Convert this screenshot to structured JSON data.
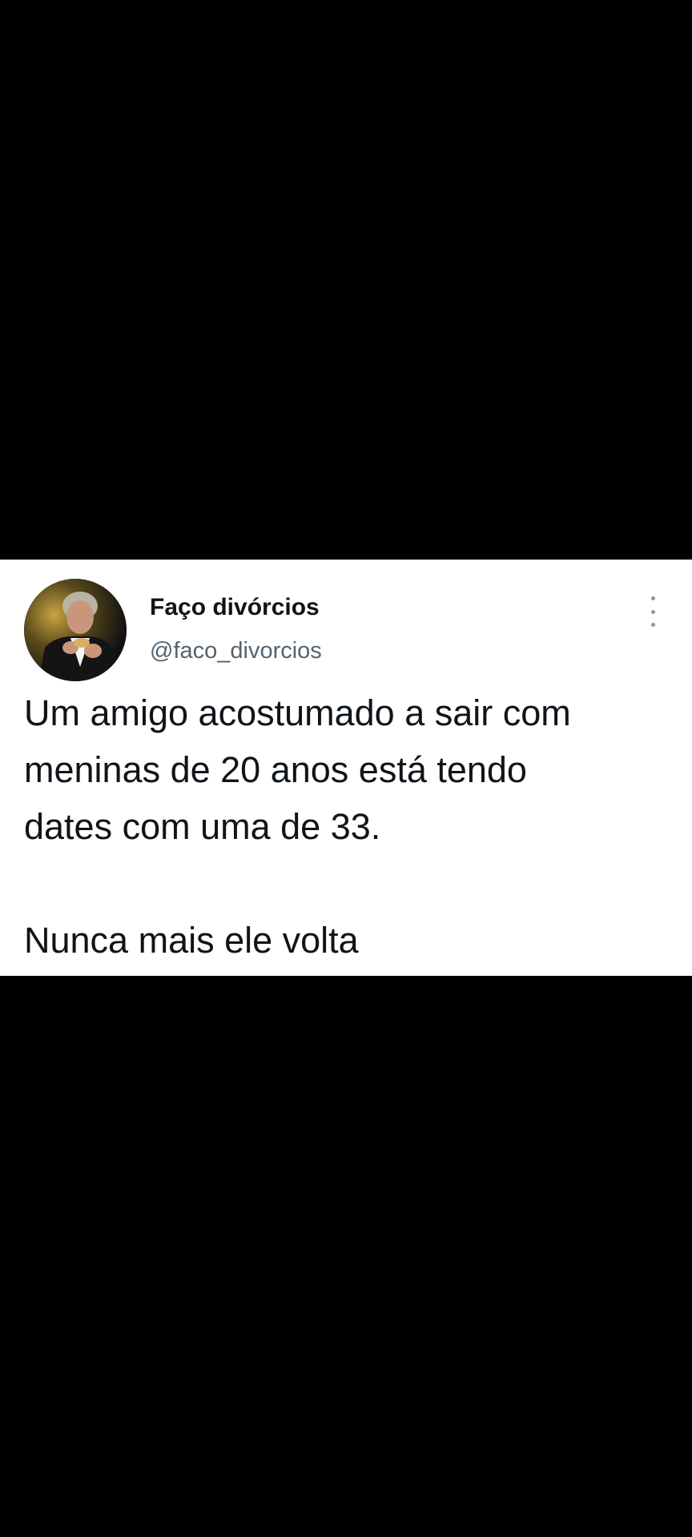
{
  "tweet": {
    "author": {
      "display_name": "Faço divórcios",
      "handle": "@faco_divorcios",
      "avatar_icon": "profile-photo"
    },
    "more_icon": "more-vertical-icon",
    "text_lines": [
      "Um amigo acostumado a sair com",
      "meninas de 20 anos está tendo",
      "dates com uma de 33."
    ],
    "text_last_line": "Nunca mais ele volta"
  },
  "colors": {
    "background": "#000000",
    "card": "#ffffff",
    "text_primary": "#0f1419",
    "text_secondary": "#536471"
  }
}
